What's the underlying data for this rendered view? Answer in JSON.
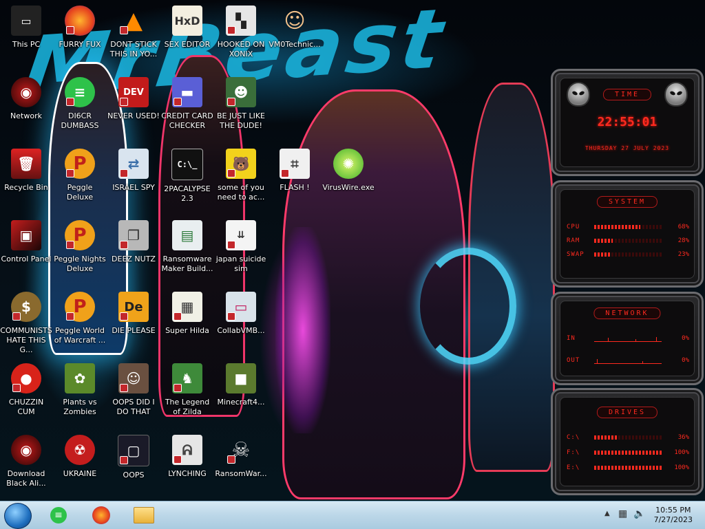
{
  "wallpaper": {
    "title": "MrBeast"
  },
  "icons": [
    {
      "label": "This PC"
    },
    {
      "label": "FURRY FUX"
    },
    {
      "label": "DONT STICK THIS IN YO..."
    },
    {
      "label": "SEX EDITOR"
    },
    {
      "label": "HOOKED ON XONIX"
    },
    {
      "label": "VM0Technic..."
    },
    {
      "label": "Network"
    },
    {
      "label": "DI6CR DUMBASS"
    },
    {
      "label": "NEVER USED!"
    },
    {
      "label": "CREDIT CARD CHECKER"
    },
    {
      "label": "BE JUST LIKE THE DUDE!"
    },
    {
      "label": "Recycle Bin"
    },
    {
      "label": "Peggle Deluxe"
    },
    {
      "label": "ISRAEL SPY"
    },
    {
      "label": "2PACALYPSE 2.3"
    },
    {
      "label": "some of you need to ac..."
    },
    {
      "label": "FLASH !"
    },
    {
      "label": "VirusWire.exe"
    },
    {
      "label": "Control Panel"
    },
    {
      "label": "Peggle Nights Deluxe"
    },
    {
      "label": "DEEZ NUTZ"
    },
    {
      "label": "Ransomware Maker Build..."
    },
    {
      "label": "japan suicide sim"
    },
    {
      "label": "COMMUNISTS HATE THIS G..."
    },
    {
      "label": "Peggle World of Warcraft ..."
    },
    {
      "label": "DIE PLEASE"
    },
    {
      "label": "Super Hilda"
    },
    {
      "label": "CollabVMB..."
    },
    {
      "label": "CHUZZIN CUM"
    },
    {
      "label": "Plants vs Zombies"
    },
    {
      "label": "OOPS DID I DO THAT"
    },
    {
      "label": "The Legend of Zilda"
    },
    {
      "label": "Minecraft4..."
    },
    {
      "label": "Download Black Ali..."
    },
    {
      "label": "UKRAINE"
    },
    {
      "label": "OOPS"
    },
    {
      "label": "LYNCHING"
    },
    {
      "label": "RansomWar..."
    }
  ],
  "widgets": {
    "time": {
      "title": "TIME",
      "clock": "22:55:01",
      "date": "THURSDAY 27 JULY 2023"
    },
    "system": {
      "title": "SYSTEM",
      "rows": [
        {
          "key": "CPU",
          "value": "68%",
          "pct": 0.68
        },
        {
          "key": "RAM",
          "value": "28%",
          "pct": 0.28
        },
        {
          "key": "SWAP",
          "value": "23%",
          "pct": 0.23
        }
      ]
    },
    "network": {
      "title": "NETWORK",
      "rows": [
        {
          "key": "IN",
          "value": "0%"
        },
        {
          "key": "OUT",
          "value": "0%"
        }
      ]
    },
    "drives": {
      "title": "DRIVES",
      "rows": [
        {
          "key": "C:\\",
          "value": "36%",
          "pct": 0.36
        },
        {
          "key": "F:\\",
          "value": "100%",
          "pct": 1.0
        },
        {
          "key": "E:\\",
          "value": "100%",
          "pct": 1.0
        }
      ]
    }
  },
  "taskbar": {
    "pinned": [
      "green-notes-app",
      "firefox",
      "file-explorer"
    ],
    "time": "10:55 PM",
    "date": "7/27/2023"
  },
  "colors": {
    "widget_accent": "#ff2a1f",
    "taskbar": "#bcd7e8",
    "shortcut_badge": "#c3272b"
  }
}
